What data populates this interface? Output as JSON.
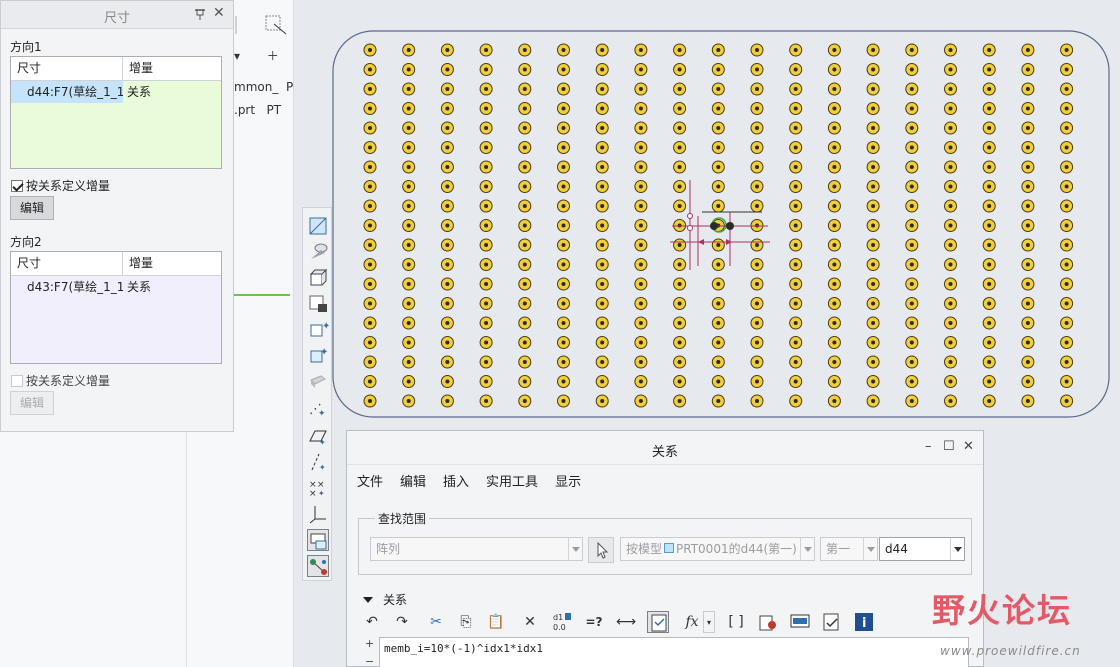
{
  "background_tree": {
    "row1": "mmon_",
    "row1b": "P",
    "row2": ".prt",
    "row2b": "PT"
  },
  "dim_panel": {
    "title": "尺寸",
    "direction1": {
      "label": "方向1",
      "col_dim": "尺寸",
      "col_inc": "增量",
      "rows": [
        {
          "dim": "d44:F7(草绘_1_1",
          "inc": "关系"
        }
      ],
      "checkbox_label": "按关系定义增量",
      "checked": true,
      "edit_label": "编辑"
    },
    "direction2": {
      "label": "方向2",
      "col_dim": "尺寸",
      "col_inc": "增量",
      "rows": [
        {
          "dim": "d43:F7(草绘_1_1",
          "inc": "关系"
        }
      ],
      "checkbox_label": "按关系定义增量",
      "checked": false,
      "edit_label": "编辑"
    }
  },
  "canvas": {
    "pattern_cols": 19,
    "pattern_rows": 19,
    "pattern_color": "#f2cf3a",
    "outline_color": "#5a6a8a"
  },
  "relations_dialog": {
    "title": "关系",
    "menu": [
      "文件",
      "编辑",
      "插入",
      "实用工具",
      "显示"
    ],
    "group_label": "查找范围",
    "combo_type": "阵列",
    "combo_model": "按模型",
    "combo_model_value": "PRT0001的d44(第一)",
    "combo_dir": "第一",
    "combo_dim": "d44",
    "section_label": "关系",
    "toolbar": {
      "undo": "↶",
      "redo": "↷",
      "cut": "✂",
      "copy": "⎘",
      "paste": "📋",
      "delete": "✕",
      "evaluate": "=?",
      "dimension": "⟷",
      "fx": "𝑓x",
      "brackets": "[ ]"
    },
    "gutter_plus": "+",
    "gutter_minus": "−",
    "code_line": "memb_i=10*(-1)^idx1*idx1"
  },
  "watermark": {
    "logo": "野火论坛",
    "url": "www.proewildfire.cn"
  }
}
